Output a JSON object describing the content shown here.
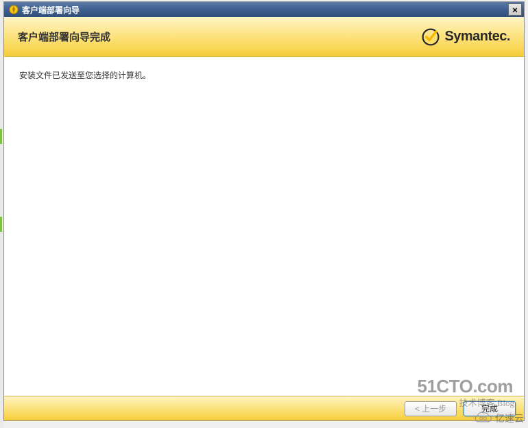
{
  "window": {
    "title": "客户端部署向导",
    "close_label": "×"
  },
  "header": {
    "title": "客户端部署向导完成",
    "brand": "Symantec."
  },
  "content": {
    "message": "安装文件已发送至您选择的计算机。"
  },
  "footer": {
    "back_label": "< 上一步",
    "finish_label": "完成"
  },
  "watermarks": {
    "site": "51CTO.com",
    "blog": "技术博客   Blog",
    "yisu": "亿速云"
  }
}
